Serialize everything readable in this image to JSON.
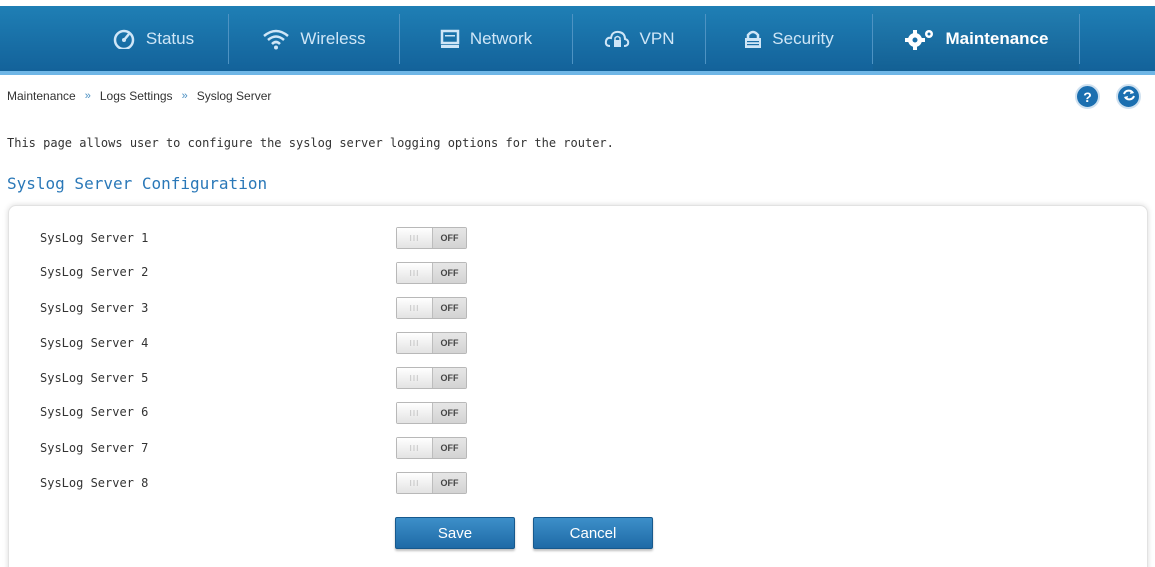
{
  "nav": {
    "items": [
      {
        "label": "Status",
        "icon": "gauge-icon",
        "active": false
      },
      {
        "label": "Wireless",
        "icon": "wifi-icon",
        "active": false
      },
      {
        "label": "Network",
        "icon": "monitor-icon",
        "active": false
      },
      {
        "label": "VPN",
        "icon": "cloud-lock-icon",
        "active": false
      },
      {
        "label": "Security",
        "icon": "lock-icon",
        "active": false
      },
      {
        "label": "Maintenance",
        "icon": "gears-icon",
        "active": true
      }
    ]
  },
  "breadcrumb": {
    "items": [
      "Maintenance",
      "Logs Settings",
      "Syslog Server"
    ],
    "separator": "»"
  },
  "help_button": "?",
  "refresh_icon": "refresh-icon",
  "page": {
    "description": "This page allows user to configure the syslog server logging options for the router.",
    "section_title": "Syslog Server Configuration"
  },
  "servers": [
    {
      "label": "SysLog Server 1",
      "state": "OFF"
    },
    {
      "label": "SysLog Server 2",
      "state": "OFF"
    },
    {
      "label": "SysLog Server 3",
      "state": "OFF"
    },
    {
      "label": "SysLog Server 4",
      "state": "OFF"
    },
    {
      "label": "SysLog Server 5",
      "state": "OFF"
    },
    {
      "label": "SysLog Server 6",
      "state": "OFF"
    },
    {
      "label": "SysLog Server 7",
      "state": "OFF"
    },
    {
      "label": "SysLog Server 8",
      "state": "OFF"
    }
  ],
  "toggle_grip": "III",
  "actions": {
    "save_label": "Save",
    "cancel_label": "Cancel"
  },
  "colors": {
    "nav_bg": "#1a6fa8",
    "accent": "#2a78b8",
    "button": "#2576b3"
  }
}
